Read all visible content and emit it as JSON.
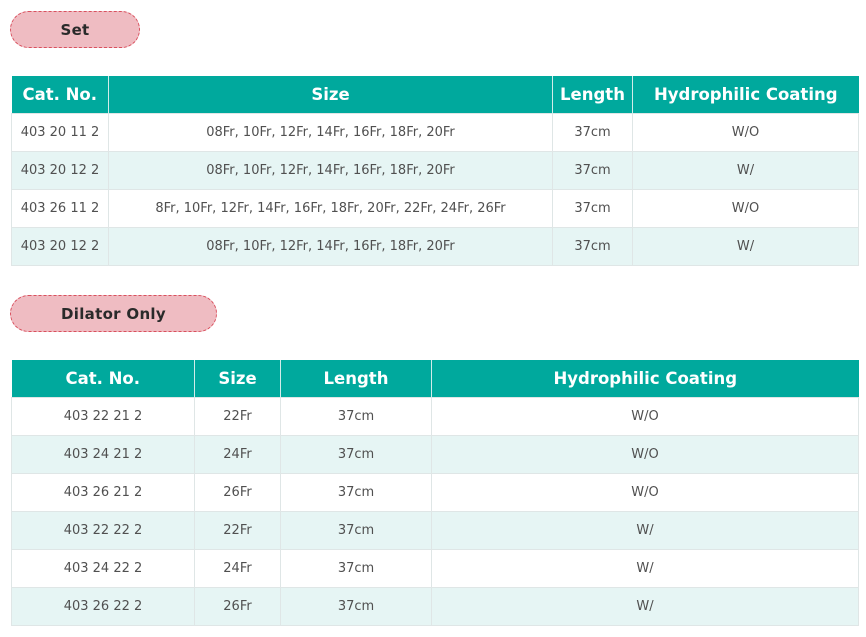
{
  "set_section": {
    "label": "Set",
    "headers": [
      "Cat. No.",
      "Size",
      "Length",
      "Hydrophilic Coating"
    ],
    "rows": [
      [
        "403 20 11 2",
        "08Fr, 10Fr, 12Fr, 14Fr, 16Fr, 18Fr, 20Fr",
        "37cm",
        "W/O"
      ],
      [
        "403 20 12 2",
        "08Fr, 10Fr, 12Fr, 14Fr, 16Fr, 18Fr, 20Fr",
        "37cm",
        "W/"
      ],
      [
        "403 26 11 2",
        "8Fr, 10Fr, 12Fr, 14Fr, 16Fr, 18Fr, 20Fr, 22Fr, 24Fr, 26Fr",
        "37cm",
        "W/O"
      ],
      [
        "403 20 12 2",
        "08Fr, 10Fr, 12Fr, 14Fr, 16Fr, 18Fr, 20Fr",
        "37cm",
        "W/"
      ]
    ]
  },
  "dilator_section": {
    "label": "Dilator Only",
    "headers": [
      "Cat. No.",
      "Size",
      "Length",
      "Hydrophilic Coating"
    ],
    "rows": [
      [
        "403 22 21 2",
        "22Fr",
        "37cm",
        "W/O"
      ],
      [
        "403 24 21 2",
        "24Fr",
        "37cm",
        "W/O"
      ],
      [
        "403 26 21 2",
        "26Fr",
        "37cm",
        "W/O"
      ],
      [
        "403 22 22 2",
        "22Fr",
        "37cm",
        "W/"
      ],
      [
        "403 24 22 2",
        "24Fr",
        "37cm",
        "W/"
      ],
      [
        "403 26 22 2",
        "26Fr",
        "37cm",
        "W/"
      ]
    ]
  },
  "colors": {
    "header_bg": "#00a99d",
    "pill_bg": "#efbcc2",
    "pill_border": "#d9505e",
    "row_alt_bg": "#e6f5f4"
  }
}
